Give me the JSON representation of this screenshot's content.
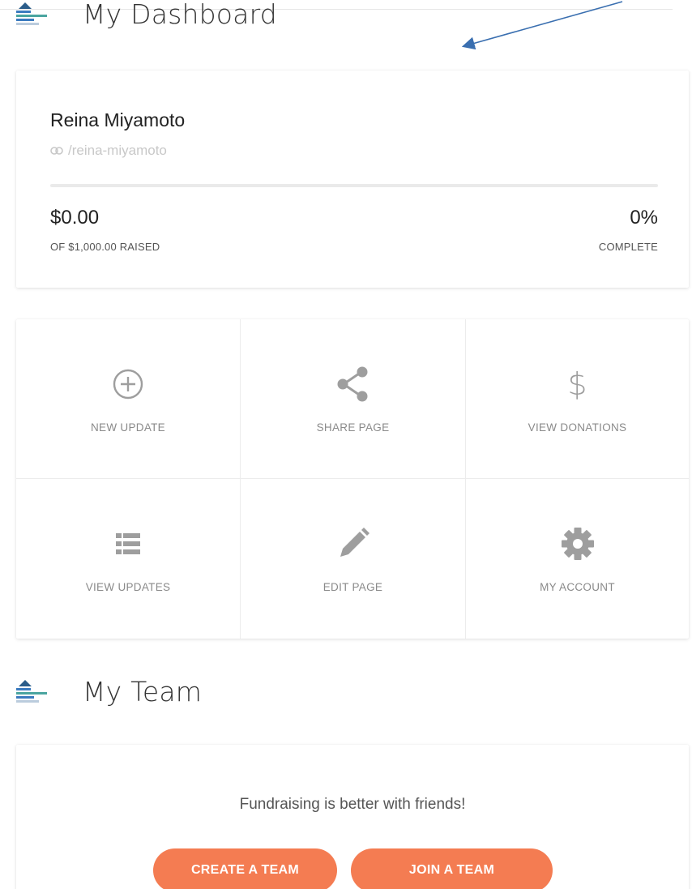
{
  "dashboard": {
    "title": "My Dashboard"
  },
  "profile": {
    "name": "Reina Miyamoto",
    "link": "/reina-miyamoto",
    "raised": "$0.00",
    "raised_label": "OF $1,000.00 RAISED",
    "percent": "0%",
    "percent_label": "COMPLETE",
    "progress_fraction": 0
  },
  "actions": [
    {
      "label": "NEW UPDATE",
      "icon": "plus-circle-icon"
    },
    {
      "label": "SHARE PAGE",
      "icon": "share-icon"
    },
    {
      "label": "VIEW DONATIONS",
      "icon": "dollar-icon"
    },
    {
      "label": "VIEW UPDATES",
      "icon": "list-icon"
    },
    {
      "label": "EDIT PAGE",
      "icon": "pencil-icon"
    },
    {
      "label": "MY ACCOUNT",
      "icon": "gear-icon"
    }
  ],
  "team": {
    "title": "My Team",
    "message": "Fundraising is better with friends!",
    "create_label": "CREATE A TEAM",
    "join_label": "JOIN A TEAM"
  },
  "colors": {
    "accent": "#f47c52",
    "icon_gray": "#9e9e9e",
    "annotation_arrow": "#3a6fb0"
  }
}
